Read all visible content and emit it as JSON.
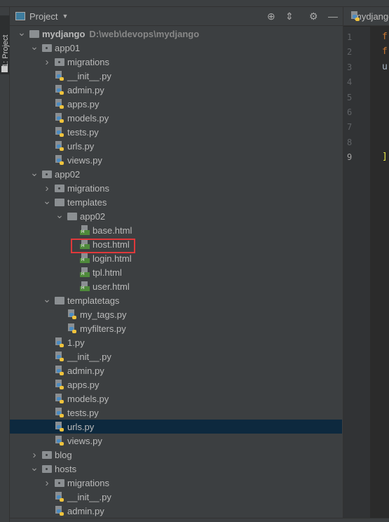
{
  "tool_window": {
    "stripe_label": "1: Project",
    "title": "Project"
  },
  "editor": {
    "tab": "mydjango",
    "lines": [
      "1",
      "2",
      "3",
      "4",
      "5",
      "6",
      "7",
      "8",
      "9"
    ],
    "code": {
      "1": "fr",
      "2": "fr",
      "3": "ur",
      "9": "]"
    }
  },
  "tree": [
    {
      "label": "mydjango",
      "path": "D:\\web\\devops\\mydjango",
      "level": 0,
      "type": "folder",
      "expanded": true,
      "bold": true
    },
    {
      "label": "app01",
      "level": 1,
      "type": "pkg",
      "expanded": true
    },
    {
      "label": "migrations",
      "level": 2,
      "type": "pkg",
      "expanded": false
    },
    {
      "label": "__init__.py",
      "level": 2,
      "type": "py"
    },
    {
      "label": "admin.py",
      "level": 2,
      "type": "py"
    },
    {
      "label": "apps.py",
      "level": 2,
      "type": "py"
    },
    {
      "label": "models.py",
      "level": 2,
      "type": "py"
    },
    {
      "label": "tests.py",
      "level": 2,
      "type": "py"
    },
    {
      "label": "urls.py",
      "level": 2,
      "type": "py"
    },
    {
      "label": "views.py",
      "level": 2,
      "type": "py"
    },
    {
      "label": "app02",
      "level": 1,
      "type": "pkg",
      "expanded": true
    },
    {
      "label": "migrations",
      "level": 2,
      "type": "pkg",
      "expanded": false
    },
    {
      "label": "templates",
      "level": 2,
      "type": "folder",
      "expanded": true
    },
    {
      "label": "app02",
      "level": 3,
      "type": "folder",
      "expanded": true
    },
    {
      "label": "base.html",
      "level": 4,
      "type": "html"
    },
    {
      "label": "host.html",
      "level": 4,
      "type": "html",
      "highlighted": true
    },
    {
      "label": "login.html",
      "level": 4,
      "type": "html"
    },
    {
      "label": "tpl.html",
      "level": 4,
      "type": "html"
    },
    {
      "label": "user.html",
      "level": 4,
      "type": "html"
    },
    {
      "label": "templatetags",
      "level": 2,
      "type": "folder",
      "expanded": true
    },
    {
      "label": "my_tags.py",
      "level": 3,
      "type": "py"
    },
    {
      "label": "myfilters.py",
      "level": 3,
      "type": "py"
    },
    {
      "label": "1.py",
      "level": 2,
      "type": "py"
    },
    {
      "label": "__init__.py",
      "level": 2,
      "type": "py"
    },
    {
      "label": "admin.py",
      "level": 2,
      "type": "py"
    },
    {
      "label": "apps.py",
      "level": 2,
      "type": "py"
    },
    {
      "label": "models.py",
      "level": 2,
      "type": "py"
    },
    {
      "label": "tests.py",
      "level": 2,
      "type": "py"
    },
    {
      "label": "urls.py",
      "level": 2,
      "type": "py",
      "selected": true
    },
    {
      "label": "views.py",
      "level": 2,
      "type": "py"
    },
    {
      "label": "blog",
      "level": 1,
      "type": "pkg",
      "expanded": false
    },
    {
      "label": "hosts",
      "level": 1,
      "type": "pkg",
      "expanded": true
    },
    {
      "label": "migrations",
      "level": 2,
      "type": "pkg",
      "expanded": false
    },
    {
      "label": "__init__.py",
      "level": 2,
      "type": "py"
    },
    {
      "label": "admin.py",
      "level": 2,
      "type": "py"
    }
  ],
  "colors": {
    "selection": "#0d293e",
    "highlight_box": "#e0393b",
    "keyword": "#cc7832"
  }
}
